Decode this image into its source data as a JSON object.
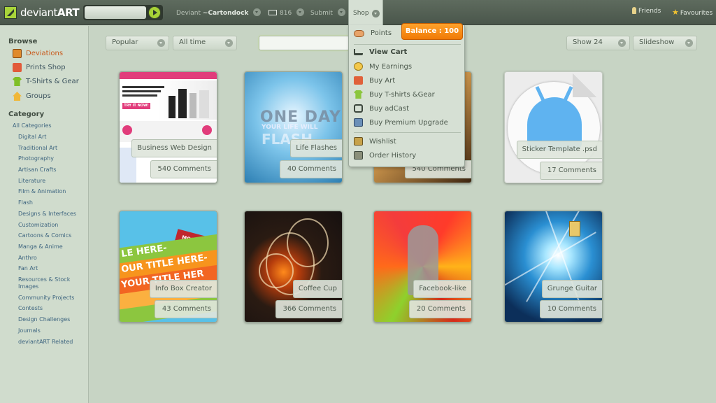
{
  "header": {
    "logo_prefix": "deviant",
    "logo_suffix": "ART",
    "deviant_label": "Deviant",
    "username": "~Cartondock",
    "messages_count": "816",
    "submit_label": "Submit",
    "shop_label": "Shop",
    "friends_label": "Friends",
    "favourites_label": "Favourites"
  },
  "sidebar": {
    "browse_heading": "Browse",
    "browse_items": [
      {
        "label": "Deviations",
        "icon": "deviations-icon",
        "active": true
      },
      {
        "label": "Prints Shop",
        "icon": "prints-icon",
        "active": false
      },
      {
        "label": "T-Shirts & Gear",
        "icon": "tshirt-icon",
        "active": false
      },
      {
        "label": "Groups",
        "icon": "home-icon",
        "active": false
      }
    ],
    "category_heading": "Category",
    "categories": [
      "All Categories",
      "Digital Art",
      "Traditional Art",
      "Photography",
      "Artisan Crafts",
      "Literature",
      "Film & Animation",
      "Flash",
      "Designs & Interfaces",
      "Customization",
      "Cartoons & Comics",
      "Manga & Anime",
      "Anthro",
      "Fan Art",
      "Resources & Stock",
      "Images",
      "Community Projects",
      "Contests",
      "Design Challenges",
      "Journals",
      "deviantART Related"
    ]
  },
  "filters": {
    "sort": "Popular",
    "time": "All time",
    "show": "Show 24",
    "slideshow": "Slideshow"
  },
  "thumbnails": [
    {
      "title": "Business Web Design",
      "comments": "540 Comments"
    },
    {
      "title": "Life Flashes",
      "comments": "40 Comments"
    },
    {
      "title": "",
      "comments": "540 Comments"
    },
    {
      "title": "Sticker Template .psd",
      "comments": "17 Comments"
    },
    {
      "title": "Info Box Creator",
      "comments": "43 Comments"
    },
    {
      "title": "Coffee Cup",
      "comments": "366 Comments"
    },
    {
      "title": "Facebook-like",
      "comments": "20 Comments"
    },
    {
      "title": "Grunge Guitar",
      "comments": "10 Comments"
    }
  ],
  "thumb_text": {
    "web_button": "TRY IT NOW!",
    "flash_line1": "ONE DAY",
    "flash_line2": "YOUR LIFE WILL",
    "flash_line3": "FLASH",
    "info_more": "MORE",
    "info_line1": "LE HERE-",
    "info_line2": "OUR TITLE HERE-",
    "info_line3": "YOUR TITLE HER"
  },
  "shop_menu": {
    "points_label": "Points",
    "balance_label": "Balance : 100",
    "items": [
      {
        "label": "View Cart",
        "icon": "cart-icon",
        "bold": true
      },
      {
        "label": "My Earnings",
        "icon": "earnings-icon",
        "bold": false
      },
      {
        "label": "Buy Art",
        "icon": "art-icon",
        "bold": false
      },
      {
        "label": "Buy T-shirts &Gear",
        "icon": "tshirt-icon",
        "bold": false
      },
      {
        "label": "Buy adCast",
        "icon": "adcast-icon",
        "bold": false
      },
      {
        "label": "Buy Premium Upgrade",
        "icon": "premium-icon",
        "bold": false
      }
    ],
    "secondary_items": [
      {
        "label": "Wishlist",
        "icon": "wishlist-icon"
      },
      {
        "label": "Order History",
        "icon": "order-history-icon"
      }
    ]
  },
  "colors": {
    "accent_green": "#a8d337",
    "balance_orange": "#f38a10",
    "active_link": "#c85a1c",
    "background": "#c7d4c4"
  }
}
